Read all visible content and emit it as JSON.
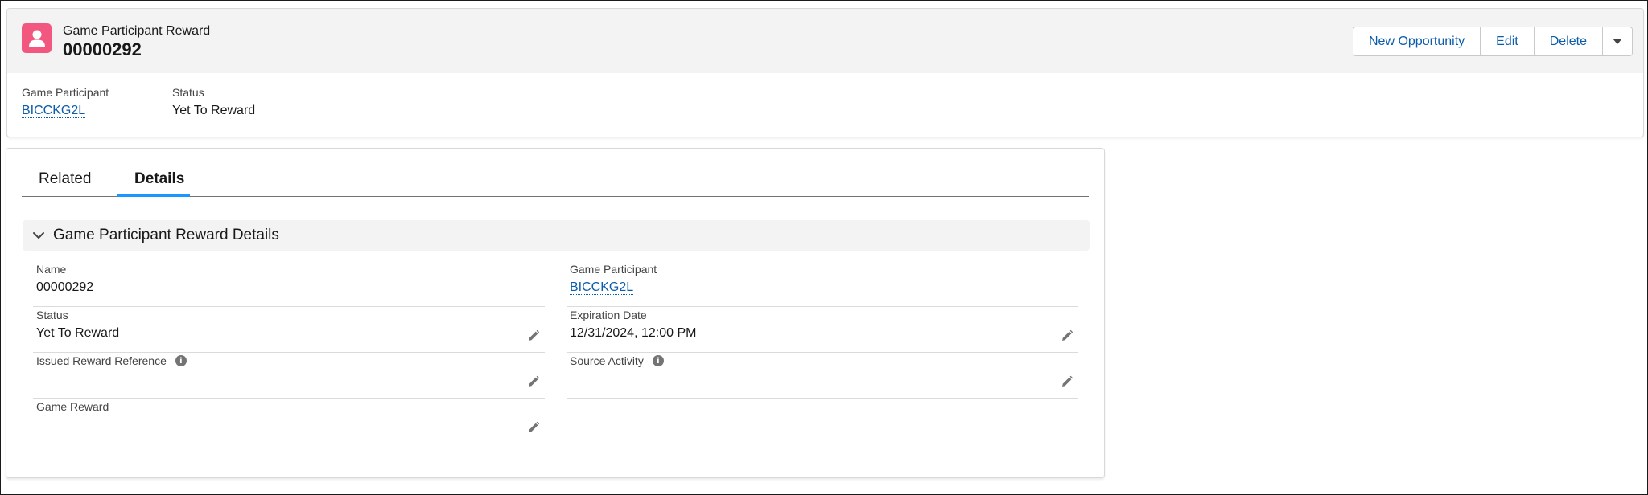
{
  "header": {
    "object_label": "Game Participant Reward",
    "record_title": "00000292",
    "icon": "person-icon",
    "accent_color": "#f1577f",
    "buttons": {
      "new_opportunity": "New Opportunity",
      "edit": "Edit",
      "delete": "Delete"
    }
  },
  "highlights": {
    "game_participant_label": "Game Participant",
    "game_participant_value": "BICCKG2L",
    "status_label": "Status",
    "status_value": "Yet To Reward"
  },
  "tabs": [
    {
      "label": "Related",
      "active": false
    },
    {
      "label": "Details",
      "active": true
    }
  ],
  "section": {
    "title": "Game Participant Reward Details"
  },
  "fields": {
    "name": {
      "label": "Name",
      "value": "00000292"
    },
    "game_participant": {
      "label": "Game Participant",
      "value": "BICCKG2L"
    },
    "status": {
      "label": "Status",
      "value": "Yet To Reward"
    },
    "expiration_date": {
      "label": "Expiration Date",
      "value": "12/31/2024, 12:00 PM"
    },
    "issued_reward_reference": {
      "label": "Issued Reward Reference",
      "value": ""
    },
    "source_activity": {
      "label": "Source Activity",
      "value": ""
    },
    "game_reward": {
      "label": "Game Reward",
      "value": ""
    }
  },
  "info_glyph": "i"
}
